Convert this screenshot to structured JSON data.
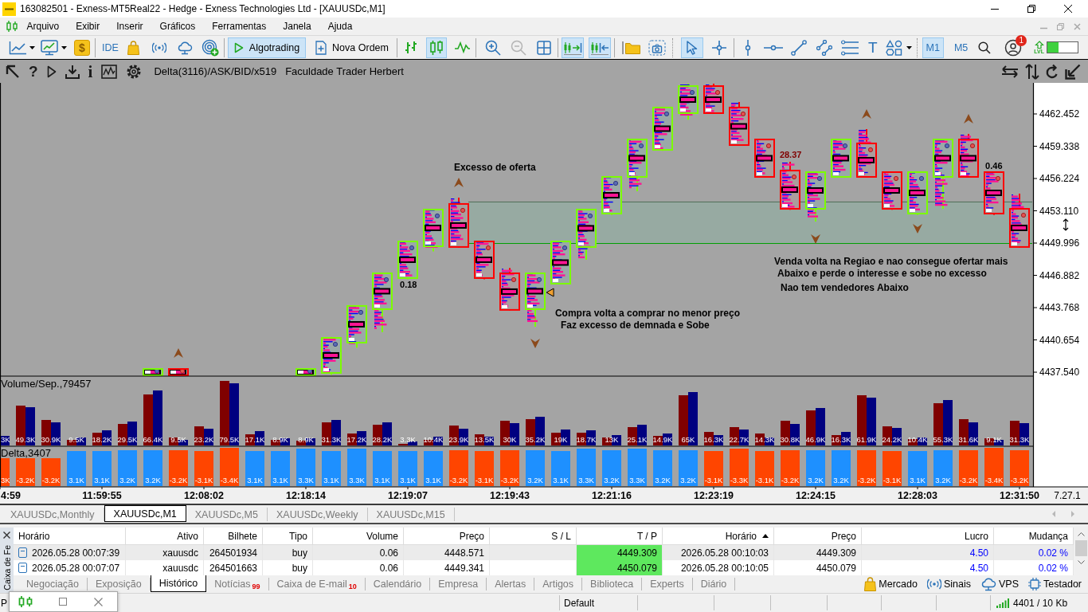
{
  "window": {
    "title": "163082501 - Exness-MT5Real22 - Hedge - Exness Technologies Ltd - [XAUUSDc,M1]"
  },
  "menu": [
    "Arquivo",
    "Exibir",
    "Inserir",
    "Gráficos",
    "Ferramentas",
    "Janela",
    "Ajuda"
  ],
  "toolbar": {
    "deposit": "$",
    "ide": "IDE",
    "algotrading": {
      "label": "Algotrading",
      "on": true
    },
    "new_order": {
      "label": "Nova Ordem"
    },
    "chart_types": [
      {
        "selected": false
      },
      {
        "selected": true
      },
      {
        "selected": false
      }
    ],
    "zoom_out": {
      "disabled": true
    },
    "auto_scroll": {
      "on": true
    },
    "chart_shift": {
      "on": true
    },
    "pointer_tools": [
      {
        "selected": true
      },
      {
        "selected": false
      }
    ],
    "text_tool": "T",
    "timeframes": [
      {
        "label": "M1",
        "selected": true
      },
      {
        "label": "M5",
        "selected": false
      }
    ],
    "account_badge": "1",
    "lvl": "LVL",
    "meter": {
      "level": 0.37
    }
  },
  "chart": {
    "tools": {
      "help": "?",
      "info": "i"
    },
    "indicator": "Delta(3116)/ASK/BID/x519",
    "caption": "Faculdade Trader Herbert",
    "price_chart": {
      "price_axis": [
        "4462.452",
        "4459.338",
        "4456.224",
        "4453.110",
        "4449.996",
        "4446.882",
        "4443.768",
        "4440.654",
        "4437.540"
      ],
      "notes": [
        {
          "kind": "text",
          "text": "Excesso de oferta",
          "color": "#000000"
        },
        {
          "kind": "value",
          "text": "0.18",
          "color": "#000000"
        },
        {
          "kind": "text",
          "text": "Compra volta a comprar no menor preço",
          "color": "#000000"
        },
        {
          "kind": "text",
          "text": "Faz excesso de demnada e Sobe",
          "color": "#000000"
        },
        {
          "kind": "value",
          "text": "28.37",
          "color": "#800000"
        },
        {
          "kind": "value",
          "text": "0.46",
          "color": "#000000"
        },
        {
          "kind": "text",
          "text": "Venda volta na Regiao e nao consegue ofertar mais",
          "color": "#000000"
        },
        {
          "kind": "text",
          "text": "Abaixo e perde o interesse e sobe no excesso",
          "color": "#000000"
        },
        {
          "kind": "text",
          "text": "Nao tem vendedores Abaixo",
          "color": "#000000"
        }
      ]
    },
    "volume_panel": {
      "title": "Volume/Sep.,79457",
      "labels": [
        "3K",
        "49.3K",
        "30.9K",
        "9.5K",
        "18.2K",
        "29.5K",
        "66.4K",
        "9.5K",
        "23.2K",
        "79.5K",
        "17.1K",
        "8.9K",
        "8.9K",
        "31.3K",
        "17.2K",
        "28.2K",
        "3.3K",
        "10.4K",
        "23.9K",
        "13.5K",
        "30K",
        "35.2K",
        "19K",
        "18.7K",
        "13K",
        "25.1K",
        "14.9K",
        "65K",
        "16.3K",
        "22.7K",
        "14.3K",
        "30.8K",
        "46.9K",
        "16.3K",
        "61.9K",
        "24.2K",
        "10.4K",
        "55.3K",
        "31.6K",
        "9.1K",
        "31.3K"
      ]
    },
    "delta_panel": {
      "title": "Delta,3407",
      "bars": [
        {
          "label": "3K",
          "color": "#ff4500"
        },
        {
          "label": "-3.2K",
          "color": "#ff4500"
        },
        {
          "label": "-3.2K",
          "color": "#ff4500"
        },
        {
          "label": "3.1K",
          "color": "#1e90ff"
        },
        {
          "label": "3.1K",
          "color": "#1e90ff"
        },
        {
          "label": "3.2K",
          "color": "#1e90ff"
        },
        {
          "label": "3.2K",
          "color": "#1e90ff"
        },
        {
          "label": "-3.2K",
          "color": "#ff4500"
        },
        {
          "label": "-3.1K",
          "color": "#ff4500"
        },
        {
          "label": "-3.4K",
          "color": "#ff4500"
        },
        {
          "label": "3.1K",
          "color": "#1e90ff"
        },
        {
          "label": "3.1K",
          "color": "#1e90ff"
        },
        {
          "label": "3.3K",
          "color": "#1e90ff"
        },
        {
          "label": "3.1K",
          "color": "#1e90ff"
        },
        {
          "label": "3.3K",
          "color": "#1e90ff"
        },
        {
          "label": "3.1K",
          "color": "#1e90ff"
        },
        {
          "label": "3.1K",
          "color": "#1e90ff"
        },
        {
          "label": "3.1K",
          "color": "#1e90ff"
        },
        {
          "label": "-3.2K",
          "color": "#ff4500"
        },
        {
          "label": "-3.1K",
          "color": "#ff4500"
        },
        {
          "label": "-3.2K",
          "color": "#ff4500"
        },
        {
          "label": "3.2K",
          "color": "#1e90ff"
        },
        {
          "label": "3.1K",
          "color": "#1e90ff"
        },
        {
          "label": "3.3K",
          "color": "#1e90ff"
        },
        {
          "label": "3.2K",
          "color": "#1e90ff"
        },
        {
          "label": "3.3K",
          "color": "#1e90ff"
        },
        {
          "label": "3.2K",
          "color": "#1e90ff"
        },
        {
          "label": "3.2K",
          "color": "#1e90ff"
        },
        {
          "label": "-3.1K",
          "color": "#ff4500"
        },
        {
          "label": "-3.3K",
          "color": "#ff4500"
        },
        {
          "label": "-3.1K",
          "color": "#ff4500"
        },
        {
          "label": "-3.2K",
          "color": "#ff4500"
        },
        {
          "label": "3.2K",
          "color": "#1e90ff"
        },
        {
          "label": "3.2K",
          "color": "#1e90ff"
        },
        {
          "label": "-3.2K",
          "color": "#ff4500"
        },
        {
          "label": "-3.1K",
          "color": "#ff4500"
        },
        {
          "label": "3.1K",
          "color": "#1e90ff"
        },
        {
          "label": "3.2K",
          "color": "#1e90ff"
        },
        {
          "label": "-3.2K",
          "color": "#ff4500"
        },
        {
          "label": "-3.4K",
          "color": "#ff4500"
        },
        {
          "label": "-3.2K",
          "color": "#ff4500"
        }
      ]
    },
    "time_axis": [
      "4:59",
      "11:59:55",
      "12:08:02",
      "12:18:14",
      "12:19:07",
      "12:19:43",
      "12:21:16",
      "12:23:19",
      "12:24:15",
      "12:28:03",
      "12:31:50"
    ],
    "axis_corner": "7.27.1"
  },
  "chart_tabs": [
    {
      "label": "XAUUSDc,Monthly",
      "selected": false
    },
    {
      "label": "XAUUSDc,M1",
      "selected": true
    },
    {
      "label": "XAUUSDc,M5",
      "selected": false
    },
    {
      "label": "XAUUSDc,Weekly",
      "selected": false
    },
    {
      "label": "XAUUSDc,M15",
      "selected": false
    }
  ],
  "toolbox": {
    "side_title": "Caixa de Fe",
    "table": {
      "columns": [
        {
          "label": "Horário",
          "sorted": false
        },
        {
          "label": "Ativo",
          "sorted": false
        },
        {
          "label": "Bilhete",
          "sorted": false
        },
        {
          "label": "Tipo",
          "sorted": false
        },
        {
          "label": "Volume",
          "sorted": false
        },
        {
          "label": "Preço",
          "sorted": false
        },
        {
          "label": "S / L",
          "sorted": false
        },
        {
          "label": "T / P",
          "sorted": false
        },
        {
          "label": "Horário",
          "sorted": true
        },
        {
          "label": "Preço",
          "sorted": false
        },
        {
          "label": "Lucro",
          "sorted": false
        },
        {
          "label": "Mudança",
          "sorted": false
        }
      ],
      "rows": [
        {
          "time": "2026.05.28 00:07:39",
          "symbol": "xauusdc",
          "ticket": "264501934",
          "type": "buy",
          "volume": "0.06",
          "price": "4448.571",
          "tp": "4449.309",
          "close_time": "2026.05.28 00:10:03",
          "close_price": "4449.309",
          "profit": "4.50",
          "change": "0.02 %",
          "tp_reached": true,
          "selected": true
        },
        {
          "time": "2026.05.28 00:07:07",
          "symbol": "xauusdc",
          "ticket": "264501663",
          "type": "buy",
          "volume": "0.06",
          "price": "4449.341",
          "tp": "4450.079",
          "close_time": "2026.05.28 00:10:05",
          "close_price": "4450.079",
          "profit": "4.50",
          "change": "0.02 %",
          "tp_reached": true,
          "selected": false
        }
      ]
    },
    "tabs": [
      {
        "label": "Negociação",
        "selected": false
      },
      {
        "label": "Exposição",
        "selected": false
      },
      {
        "label": "Histórico",
        "selected": true
      },
      {
        "label": "Notícias",
        "badge": "99",
        "selected": false
      },
      {
        "label": "Caixa de E-mail",
        "badge": "10",
        "selected": false
      },
      {
        "label": "Calendário",
        "selected": false
      },
      {
        "label": "Empresa",
        "selected": false
      },
      {
        "label": "Alertas",
        "selected": false
      },
      {
        "label": "Artigos",
        "selected": false
      },
      {
        "label": "Biblioteca",
        "selected": false
      },
      {
        "label": "Experts",
        "selected": false
      },
      {
        "label": "Diário",
        "selected": false
      }
    ],
    "links": [
      "Mercado",
      "Sinais",
      "VPS",
      "Testador"
    ]
  },
  "status_bar": {
    "fields": [
      "P",
      "Default"
    ],
    "traffic": "4401 / 10 Kb"
  }
}
